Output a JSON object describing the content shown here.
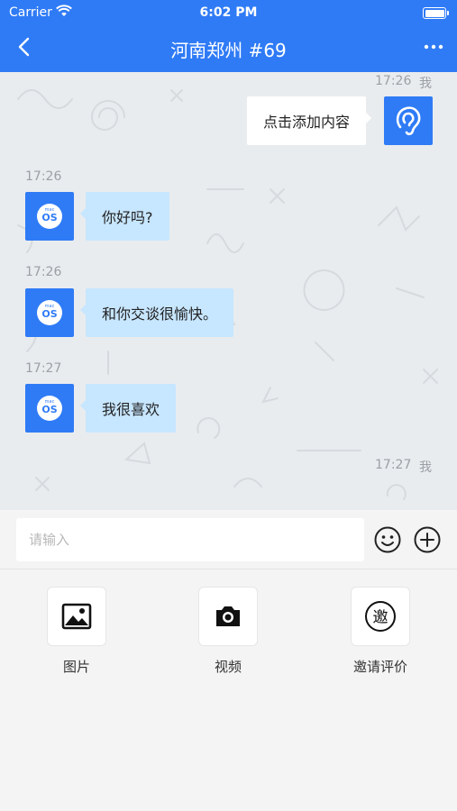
{
  "status_bar": {
    "carrier": "Carrier",
    "time": "6:02 PM"
  },
  "nav": {
    "title": "河南郑州 #69"
  },
  "messages": [
    {
      "side": "right",
      "time": "17:26",
      "sender": "我",
      "text": "点击添加内容"
    },
    {
      "side": "left",
      "time": "17:26",
      "text": "你好吗?"
    },
    {
      "side": "left",
      "time": "17:26",
      "text": "和你交谈很愉快。"
    },
    {
      "side": "left",
      "time": "17:27",
      "text": "我很喜欢"
    },
    {
      "side": "right",
      "time": "17:27",
      "sender": "我",
      "text": ""
    }
  ],
  "avatar": {
    "small": "mac",
    "main": "OS"
  },
  "input": {
    "placeholder": "请输入",
    "value": ""
  },
  "tools": [
    {
      "label": "图片",
      "icon": "image-icon"
    },
    {
      "label": "视频",
      "icon": "camera-icon"
    },
    {
      "label": "邀请评价",
      "icon": "invite-icon",
      "glyph": "邀"
    }
  ],
  "colors": {
    "accent": "#2f7bf6",
    "bubble_left": "#c7e6ff",
    "bubble_right": "#ffffff",
    "chat_bg": "#e9ecef"
  }
}
